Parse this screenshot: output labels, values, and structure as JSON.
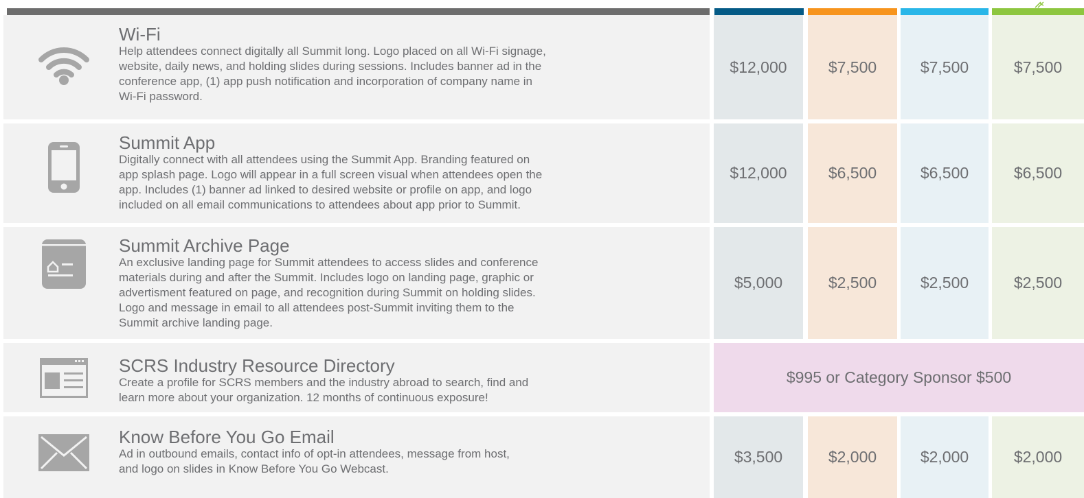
{
  "colors": {
    "bar_gray": "#6d6d6d",
    "bar_blue_dark": "#045a86",
    "bar_orange": "#f7941d",
    "bar_cyan": "#29b6e8",
    "bar_green": "#8dc63f"
  },
  "rows": [
    {
      "icon": "wifi-icon",
      "title": "Wi-Fi",
      "lines": [
        "Help attendees connect digitally all Summit long. Logo placed on all Wi-Fi signage,",
        "website, daily news, and holding slides during sessions. Includes banner ad in the",
        "conference app, (1) app push notification and incorporation of company name in",
        "Wi-Fi password."
      ],
      "prices": [
        "$12,000",
        "$7,500",
        "$7,500",
        "$7,500"
      ]
    },
    {
      "icon": "smartphone-icon",
      "title": "Summit App",
      "lines": [
        "Digitally connect with all attendees using the Summit App. Branding featured on",
        "app splash page. Logo will appear in a full screen visual when attendees open the",
        "app. Includes (1) banner ad linked to desired website or profile on app, and logo",
        "included on all email communications to attendees about app prior to Summit."
      ],
      "prices": [
        "$12,000",
        "$6,500",
        "$6,500",
        "$6,500"
      ]
    },
    {
      "icon": "archive-page-icon",
      "title": "Summit Archive Page",
      "lines": [
        "An exclusive landing page for Summit attendees to access slides and conference",
        "materials during and after the Summit. Includes logo on landing page, graphic or",
        "advertisment featured on page, and recognition during Summit on holding slides.",
        "Logo and message in email to all attendees post-Summit inviting them to the",
        "Summit archive landing page."
      ],
      "prices": [
        "$5,000",
        "$2,500",
        "$2,500",
        "$2,500"
      ]
    },
    {
      "icon": "web-directory-icon",
      "title": "SCRS Industry Resource Directory",
      "lines": [
        "Create a profile for SCRS members and the industry abroad to search, find and",
        "learn more about your organization. 12 months of continuous exposure!"
      ],
      "combined_price": "$995 or Category Sponsor $500"
    },
    {
      "icon": "envelope-icon",
      "title": "Know Before You Go Email",
      "lines": [
        "Ad in outbound emails, contact info of opt-in attendees, message from host,",
        "and logo on slides in Know Before You Go Webcast."
      ],
      "prices": [
        "$3,500",
        "$2,000",
        "$2,000",
        "$2,000"
      ]
    }
  ]
}
